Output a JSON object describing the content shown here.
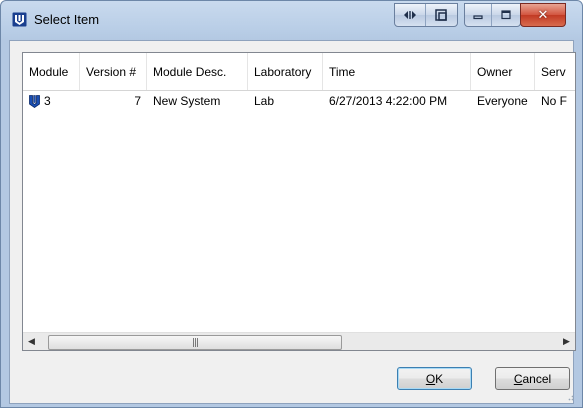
{
  "window": {
    "title": "Select Item",
    "titlebar_buttons": [
      {
        "name": "dock-icon",
        "glyph": "◁▷"
      },
      {
        "name": "restore-app-icon",
        "glyph": "⧉"
      }
    ]
  },
  "table": {
    "columns": [
      {
        "label": "Module"
      },
      {
        "label": "Version #"
      },
      {
        "label": "Module Desc."
      },
      {
        "label": "Laboratory"
      },
      {
        "label": "Time"
      },
      {
        "label": "Owner"
      },
      {
        "label": "Serv"
      }
    ],
    "rows": [
      {
        "module": "3",
        "version": "7",
        "desc": "New System",
        "laboratory": "Lab",
        "time": "6/27/2013 4:22:00 PM",
        "owner": "Everyone",
        "server": "No F"
      }
    ]
  },
  "scrollbar": {
    "left_arrow": "◀",
    "right_arrow": "▶",
    "thumb_grip": "|||"
  },
  "buttons": {
    "ok": {
      "accel": "O",
      "rest": "K"
    },
    "cancel": {
      "accel": "C",
      "rest": "ancel"
    }
  },
  "colors": {
    "titlebar": "#c9daee",
    "close": "#c23a24",
    "icon_blue": "#1a4fb5"
  }
}
